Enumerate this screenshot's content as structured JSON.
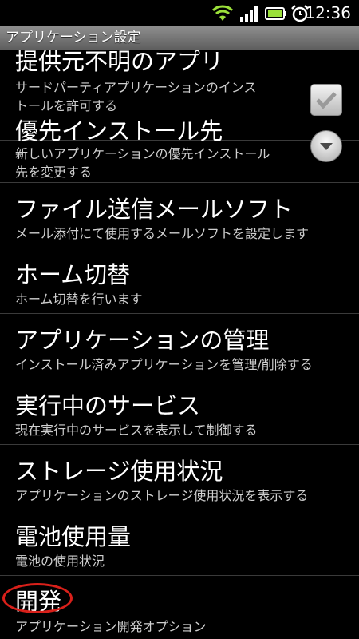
{
  "status_bar": {
    "time": "12:36",
    "icons": [
      "wifi-icon",
      "signal-icon",
      "battery-icon",
      "alarm-icon"
    ]
  },
  "title": "アプリケーション設定",
  "items": [
    {
      "title": "提供元不明のアプリ",
      "subtitle_lines": [
        "サードパーティアプリケーションのインス",
        "トールを許可する"
      ],
      "control": "checkbox",
      "checked": true
    },
    {
      "title": "優先インストール先",
      "subtitle_lines": [
        "新しいアプリケーションの優先インストール",
        "先を変更する"
      ],
      "control": "dropdown"
    },
    {
      "title": "ファイル送信メールソフト",
      "subtitle_lines": [
        "メール添付にて使用するメールソフトを設定します"
      ]
    },
    {
      "title": "ホーム切替",
      "subtitle_lines": [
        "ホーム切替を行います"
      ]
    },
    {
      "title": "アプリケーションの管理",
      "subtitle_lines": [
        "インストール済みアプリケーションを管理/削除する"
      ]
    },
    {
      "title": "実行中のサービス",
      "subtitle_lines": [
        "現在実行中のサービスを表示して制御する"
      ]
    },
    {
      "title": "ストレージ使用状況",
      "subtitle_lines": [
        "アプリケーションのストレージ使用状況を表示する"
      ]
    },
    {
      "title": "電池使用量",
      "subtitle_lines": [
        "電池の使用状況"
      ]
    },
    {
      "title": "開発",
      "subtitle_lines": [
        "アプリケーション開発オプション"
      ],
      "highlighted": true
    }
  ],
  "colors": {
    "background": "#000000",
    "highlight_circle": "#d9201a",
    "title_bar": "#7a7a7a",
    "wifi": "#9be03a",
    "battery": "#9be03a"
  }
}
